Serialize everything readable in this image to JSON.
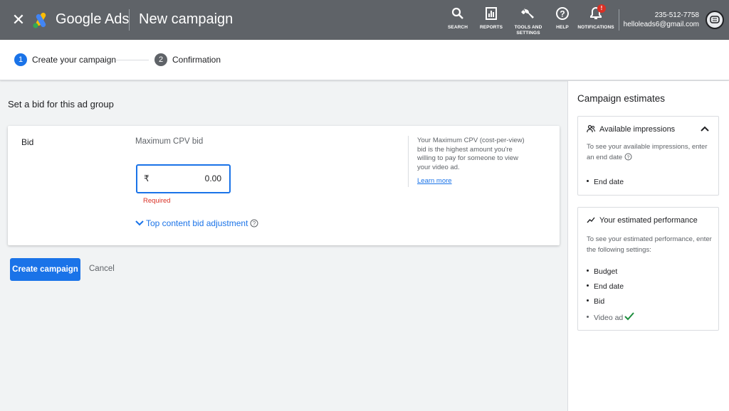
{
  "topbar": {
    "brand": "Google Ads",
    "title": "New campaign",
    "tools": {
      "search": "SEARCH",
      "reports": "REPORTS",
      "tools_line1": "TOOLS AND",
      "tools_line2": "SETTINGS",
      "help": "HELP",
      "notifications": "NOTIFICATIONS"
    },
    "notification_badge": "!",
    "account_phone": "235-512-7758",
    "account_email": "helloleads6@gmail.com"
  },
  "stepper": {
    "steps": [
      {
        "number": "1",
        "label": "Create your campaign",
        "active": true
      },
      {
        "number": "2",
        "label": "Confirmation",
        "active": false
      }
    ]
  },
  "main": {
    "section_title": "Set a bid for this ad group",
    "bid": {
      "label": "Bid",
      "field_label": "Maximum CPV bid",
      "currency": "₹",
      "value": "0.00",
      "error": "Required",
      "adjust_link": "Top content bid adjustment",
      "info_text": "Your Maximum CPV (cost-per-view) bid is the highest amount you're willing to pay for someone to view your video ad.",
      "learn_more": "Learn more"
    },
    "create_button": "Create campaign",
    "cancel_button": "Cancel"
  },
  "estimates": {
    "title": "Campaign estimates",
    "impressions": {
      "heading": "Available impressions",
      "text": "To see your available impressions, enter an end date",
      "items": [
        "End date"
      ]
    },
    "performance": {
      "heading": "Your estimated performance",
      "text": "To see your estimated performance, enter the following settings:",
      "items": [
        "Budget",
        "End date",
        "Bid",
        "Video ad"
      ]
    }
  },
  "colors": {
    "topbar": "#5f6368",
    "accent": "#1a73e8",
    "error": "#d93025",
    "success": "#1e8e3e"
  }
}
